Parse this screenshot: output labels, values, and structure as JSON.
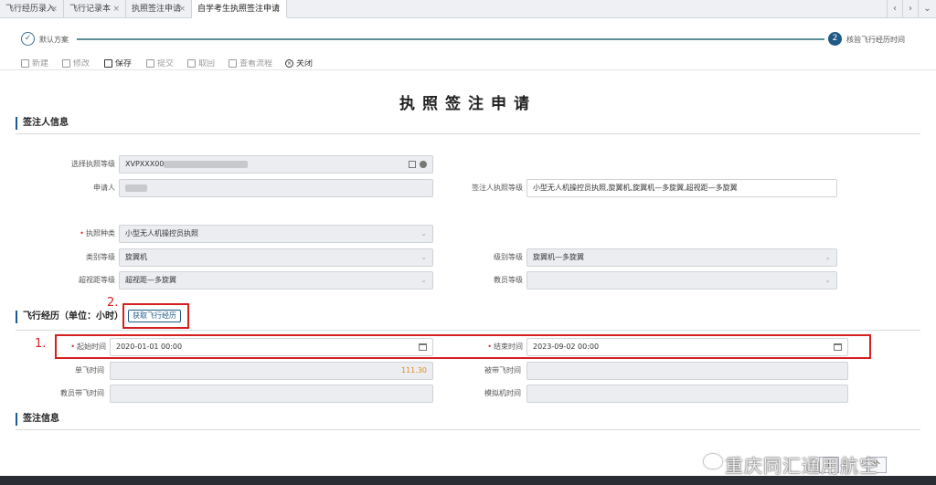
{
  "tabs": [
    {
      "label": "飞行经历录入",
      "closable": true,
      "active": false
    },
    {
      "label": "飞行记录本",
      "closable": true,
      "active": false
    },
    {
      "label": "执照签注申请",
      "closable": true,
      "active": false
    },
    {
      "label": "自学考生执照签注申请",
      "closable": true,
      "active": true
    }
  ],
  "tab_controls": {
    "prev": "‹",
    "next": "›",
    "menu": "⌄"
  },
  "steps": [
    {
      "index": "✓",
      "label": "默认方案",
      "state": "done"
    },
    {
      "index": "2",
      "label": "核验飞行经历时间",
      "state": "current"
    }
  ],
  "toolbar": {
    "new": "新建",
    "edit": "修改",
    "save": "保存",
    "submit": "提交",
    "withdraw": "取回",
    "view_flow": "查看流程",
    "close": "关闭"
  },
  "page_title": "执照签注申请",
  "sections": {
    "signer_info": "签注人信息",
    "flight_history": "飞行经历（单位：小时）",
    "endorsement_info": "签注信息"
  },
  "signer": {
    "select_license_label": "选择执照等级",
    "select_license_value": "XVPXXX00",
    "applicant_label": "申请人",
    "signer_license_label": "签注人执照等级",
    "signer_license_value": "小型无人机操控员执照,旋翼机,旋翼机—多旋翼,超视距—多旋翼"
  },
  "license": {
    "type_label": "执照种类",
    "type_value": "小型无人机操控员执照",
    "category_label": "类别等级",
    "category_value": "旋翼机",
    "class_label": "级别等级",
    "class_value": "旋翼机—多旋翼",
    "bvlos_label": "超视距等级",
    "bvlos_value": "超视距—多旋翼",
    "instructor_label": "教员等级",
    "instructor_value": ""
  },
  "flight": {
    "fetch_button": "获取飞行经历",
    "start_label": "起始时间",
    "start_value": "2020-01-01  00:00",
    "end_label": "结束时间",
    "end_value": "2023-09-02  00:00",
    "solo_label": "单飞时间",
    "solo_value": "111.30",
    "dual_label": "被带飞时间",
    "dual_value": "",
    "instructor_dual_label": "教员带飞时间",
    "instructor_dual_value": "",
    "sim_label": "模拟机时间",
    "sim_value": ""
  },
  "annotations": {
    "one": "1.",
    "two": "2."
  },
  "bottom_buttons": {
    "prev": "上",
    "next": "个"
  },
  "watermark": "重庆同汇通用航空",
  "colors": {
    "accent": "#1f5a86",
    "required": "#d9302a",
    "annotation": "#d71f1f",
    "solo_value": "#e08a1e"
  }
}
